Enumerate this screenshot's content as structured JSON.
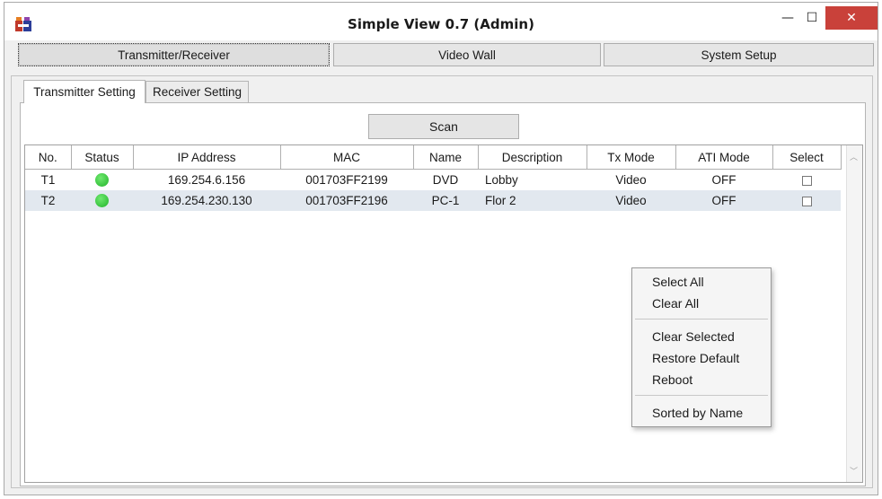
{
  "window": {
    "title": "Simple View 0.7 (Admin)",
    "minimize": "—",
    "maximize": "☐",
    "close": "✕"
  },
  "top_tabs": [
    "Transmitter/Receiver",
    "Video Wall",
    "System Setup"
  ],
  "sub_tabs": [
    "Transmitter Setting",
    "Receiver Setting"
  ],
  "scan_label": "Scan",
  "table": {
    "columns": [
      "No.",
      "Status",
      "IP Address",
      "MAC",
      "Name",
      "Description",
      "Tx Mode",
      "ATI Mode",
      "Select"
    ],
    "rows": [
      {
        "no": "T1",
        "status": "online",
        "ip": "169.254.6.156",
        "mac": "001703FF2199",
        "name": "DVD",
        "description": "Lobby",
        "tx_mode": "Video",
        "ati_mode": "OFF",
        "selected": false
      },
      {
        "no": "T2",
        "status": "online",
        "ip": "169.254.230.130",
        "mac": "001703FF2196",
        "name": "PC-1",
        "description": "Flor 2",
        "tx_mode": "Video",
        "ati_mode": "OFF",
        "selected": false
      }
    ]
  },
  "context_menu": {
    "items": [
      "Select All",
      "Clear All",
      "Clear Selected",
      "Restore Default",
      "Reboot",
      "Sorted by Name"
    ]
  },
  "colors": {
    "status_online": "#2ecc40",
    "close_button": "#c9413a",
    "selected_row": "#e2e8ef"
  },
  "icons": {
    "app": "app-logo-icon",
    "status": "green-dot-icon",
    "scroll_up": "chevron-up-icon",
    "scroll_down": "chevron-down-icon"
  }
}
